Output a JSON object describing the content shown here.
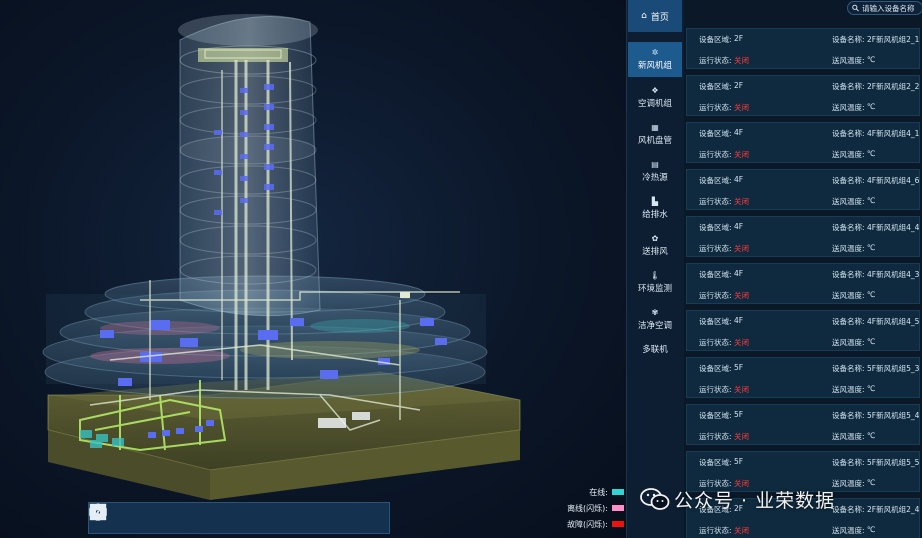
{
  "viewport": {
    "toolbar": {
      "tools": [
        {
          "name": "layers-tool",
          "icon": "grid-icon"
        },
        {
          "name": "home-view-tool",
          "icon": "home-icon"
        },
        {
          "name": "zoom-area-tool",
          "icon": "zoom-box-icon"
        },
        {
          "name": "section-tool",
          "icon": "bar-icon"
        },
        {
          "name": "floor-tool",
          "icon": "floor-icon"
        },
        {
          "name": "person-tool",
          "icon": "person-icon"
        },
        {
          "name": "roam-tool",
          "icon": "pin-icon"
        },
        {
          "name": "list-tool",
          "icon": "list-icon"
        },
        {
          "name": "settings-tool",
          "icon": "gear-icon"
        },
        {
          "name": "info-tool",
          "icon": "info-icon"
        },
        {
          "name": "fullscreen-tool",
          "icon": "fullscreen-icon"
        }
      ]
    },
    "legend": [
      {
        "label": "在线:",
        "color": "#2fd5d5"
      },
      {
        "label": "离线(闪烁):",
        "color": "#ff8fc8"
      },
      {
        "label": "故障(闪烁):",
        "color": "#ee1111"
      }
    ]
  },
  "nav": {
    "home": {
      "label": "首页",
      "icon": "home-icon"
    },
    "items": [
      {
        "label": "新风机组",
        "icon": "fan-icon",
        "active": true
      },
      {
        "label": "空调机组",
        "icon": "ac-icon",
        "active": false
      },
      {
        "label": "风机盘管",
        "icon": "grid-icon",
        "active": false
      },
      {
        "label": "冷热源",
        "icon": "heat-source-icon",
        "active": false
      },
      {
        "label": "给排水",
        "icon": "pipe-icon",
        "active": false
      },
      {
        "label": "送排风",
        "icon": "fan-icon",
        "active": false
      },
      {
        "label": "环境监测",
        "icon": "thermometer-icon",
        "active": false
      },
      {
        "label": "洁净空调",
        "icon": "clean-ac-icon",
        "active": false
      },
      {
        "label": "多联机",
        "icon": "",
        "active": false
      }
    ]
  },
  "panel": {
    "search": {
      "placeholder": "请输入设备名称",
      "value": ""
    },
    "labels": {
      "area": "设备区域:",
      "name": "设备名称:",
      "status": "运行状态:",
      "temp": "送风温度:"
    },
    "devices": [
      {
        "area": "2F",
        "name": "2F新风机组2_1",
        "status": "关闭",
        "temp": "℃"
      },
      {
        "area": "2F",
        "name": "2F新风机组2_2",
        "status": "关闭",
        "temp": "℃"
      },
      {
        "area": "4F",
        "name": "4F新风机组4_1",
        "status": "关闭",
        "temp": "℃"
      },
      {
        "area": "4F",
        "name": "4F新风机组4_6",
        "status": "关闭",
        "temp": "℃"
      },
      {
        "area": "4F",
        "name": "4F新风机组4_4",
        "status": "关闭",
        "temp": "℃"
      },
      {
        "area": "4F",
        "name": "4F新风机组4_3",
        "status": "关闭",
        "temp": "℃"
      },
      {
        "area": "4F",
        "name": "4F新风机组4_5",
        "status": "关闭",
        "temp": "℃"
      },
      {
        "area": "5F",
        "name": "5F新风机组5_3",
        "status": "关闭",
        "temp": "℃"
      },
      {
        "area": "5F",
        "name": "5F新风机组5_4",
        "status": "关闭",
        "temp": "℃"
      },
      {
        "area": "5F",
        "name": "5F新风机组5_5",
        "status": "关闭",
        "temp": "℃"
      },
      {
        "area": "2F",
        "name": "2F新风机组2_4",
        "status": "关闭",
        "temp": "℃"
      }
    ]
  },
  "watermark": {
    "text": "公众号 · 业荣数据"
  }
}
